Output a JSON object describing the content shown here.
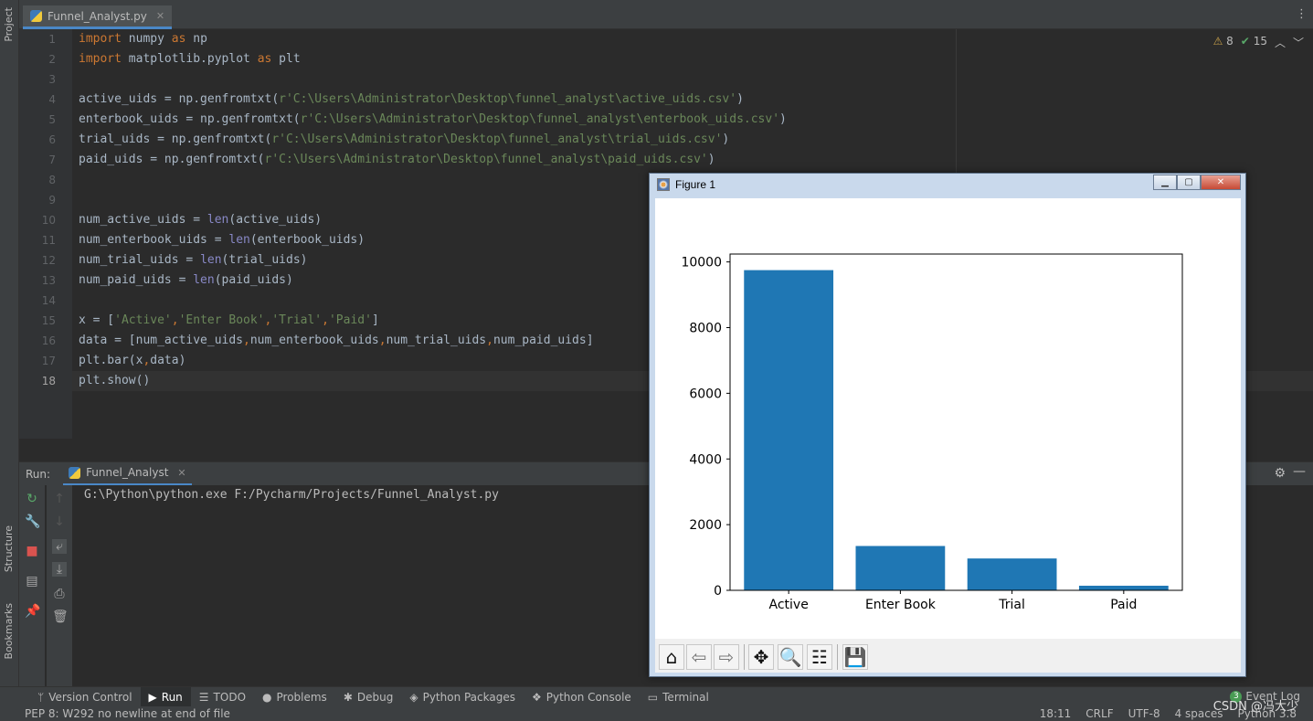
{
  "tool_windows_left": {
    "project": "Project",
    "structure": "Structure",
    "bookmarks": "Bookmarks"
  },
  "editor": {
    "tab": {
      "filename": "Funnel_Analyst.py"
    },
    "inspections": {
      "warnings": "8",
      "ok": "15"
    },
    "line_numbers": [
      "1",
      "2",
      "3",
      "4",
      "5",
      "6",
      "7",
      "8",
      "9",
      "10",
      "11",
      "12",
      "13",
      "14",
      "15",
      "16",
      "17",
      "18"
    ],
    "current_line": 18
  },
  "run": {
    "label": "Run:",
    "tab": "Funnel_Analyst",
    "console": "G:\\Python\\python.exe F:/Pycharm/Projects/Funnel_Analyst.py"
  },
  "bottom_tools": [
    "Version Control",
    "Run",
    "TODO",
    "Problems",
    "Debug",
    "Python Packages",
    "Python Console",
    "Terminal"
  ],
  "event_log": {
    "count": "3",
    "label": "Event Log"
  },
  "status": {
    "message": "PEP 8: W292 no newline at end of file",
    "position": "18:11",
    "line_sep": "CRLF",
    "encoding": "UTF-8",
    "indent": "4 spaces",
    "interpreter": "Python 3.8"
  },
  "watermark": "CSDN @冯大少",
  "figure": {
    "title": "Figure 1",
    "toolbar_icons": [
      "home-icon",
      "back-icon",
      "forward-icon",
      "pan-icon",
      "zoom-icon",
      "configure-subplots-icon",
      "save-icon"
    ]
  },
  "chart_data": {
    "type": "bar",
    "categories": [
      "Active",
      "Enter Book",
      "Trial",
      "Paid"
    ],
    "values": [
      9750,
      1350,
      970,
      140
    ],
    "ylim": [
      0,
      10240
    ],
    "yticks": [
      0,
      2000,
      4000,
      6000,
      8000,
      10000
    ],
    "bar_color": "#1f77b4",
    "title": "",
    "xlabel": "",
    "ylabel": "",
    "grid": false
  }
}
